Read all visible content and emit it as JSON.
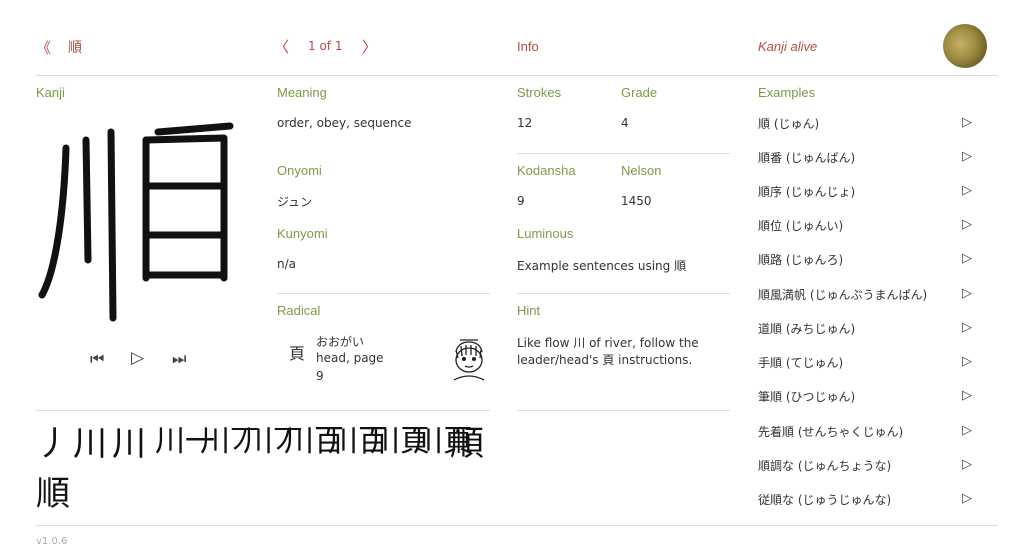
{
  "header": {
    "back_glyph": "《",
    "kanji": "順",
    "prev_glyph": "〈",
    "pager": "1 of 1",
    "next_glyph": "〉",
    "info_title": "Info",
    "app_title": "Kanji alive"
  },
  "kanji_section": {
    "label": "Kanji",
    "character": "順"
  },
  "meaning": {
    "label": "Meaning",
    "value": "order, obey, sequence"
  },
  "onyomi": {
    "label": "Onyomi",
    "value": "ジュン"
  },
  "kunyomi": {
    "label": "Kunyomi",
    "value": "n/a"
  },
  "radical": {
    "label": "Radical",
    "character": "頁",
    "reading": "おおがい",
    "meaning": "head, page",
    "strokes": "9"
  },
  "info": {
    "strokes_label": "Strokes",
    "strokes_value": "12",
    "grade_label": "Grade",
    "grade_value": "4",
    "kodansha_label": "Kodansha",
    "kodansha_value": "9",
    "nelson_label": "Nelson",
    "nelson_value": "1450",
    "luminous_label": "Luminous",
    "luminous_text": "Example sentences using 順",
    "hint_label": "Hint",
    "hint_line1": "Like flow 川 of river, follow the",
    "hint_line2": "leader/head's 頁 instructions."
  },
  "examples": {
    "label": "Examples",
    "items": [
      "順 (じゅん)",
      "順番 (じゅんばん)",
      "順序 (じゅんじょ)",
      "順位 (じゅんい)",
      "順路 (じゅんろ)",
      "順風満帆 (じゅんぷうまんぱん)",
      "道順 (みちじゅん)",
      "手順 (てじゅん)",
      "筆順 (ひつじゅん)",
      "先着順 (せんちゃくじゅん)",
      "順調な (じゅんちょうな)",
      "従順な (じゅうじゅんな)"
    ]
  },
  "stroke_sequence": [
    "丿",
    "川",
    "川",
    "川一",
    "川丆",
    "川丆",
    "川百",
    "川百",
    "川頁",
    "川頁",
    "順",
    "順"
  ],
  "playback": {
    "first_glyph": "⏮",
    "play_glyph": "▷",
    "last_glyph": "⏭"
  },
  "footer": {
    "version": "v1.0.6"
  },
  "colors": {
    "accent_green": "#7e9a4a",
    "accent_red": "#b05040",
    "divider": "#dcdcdc"
  }
}
